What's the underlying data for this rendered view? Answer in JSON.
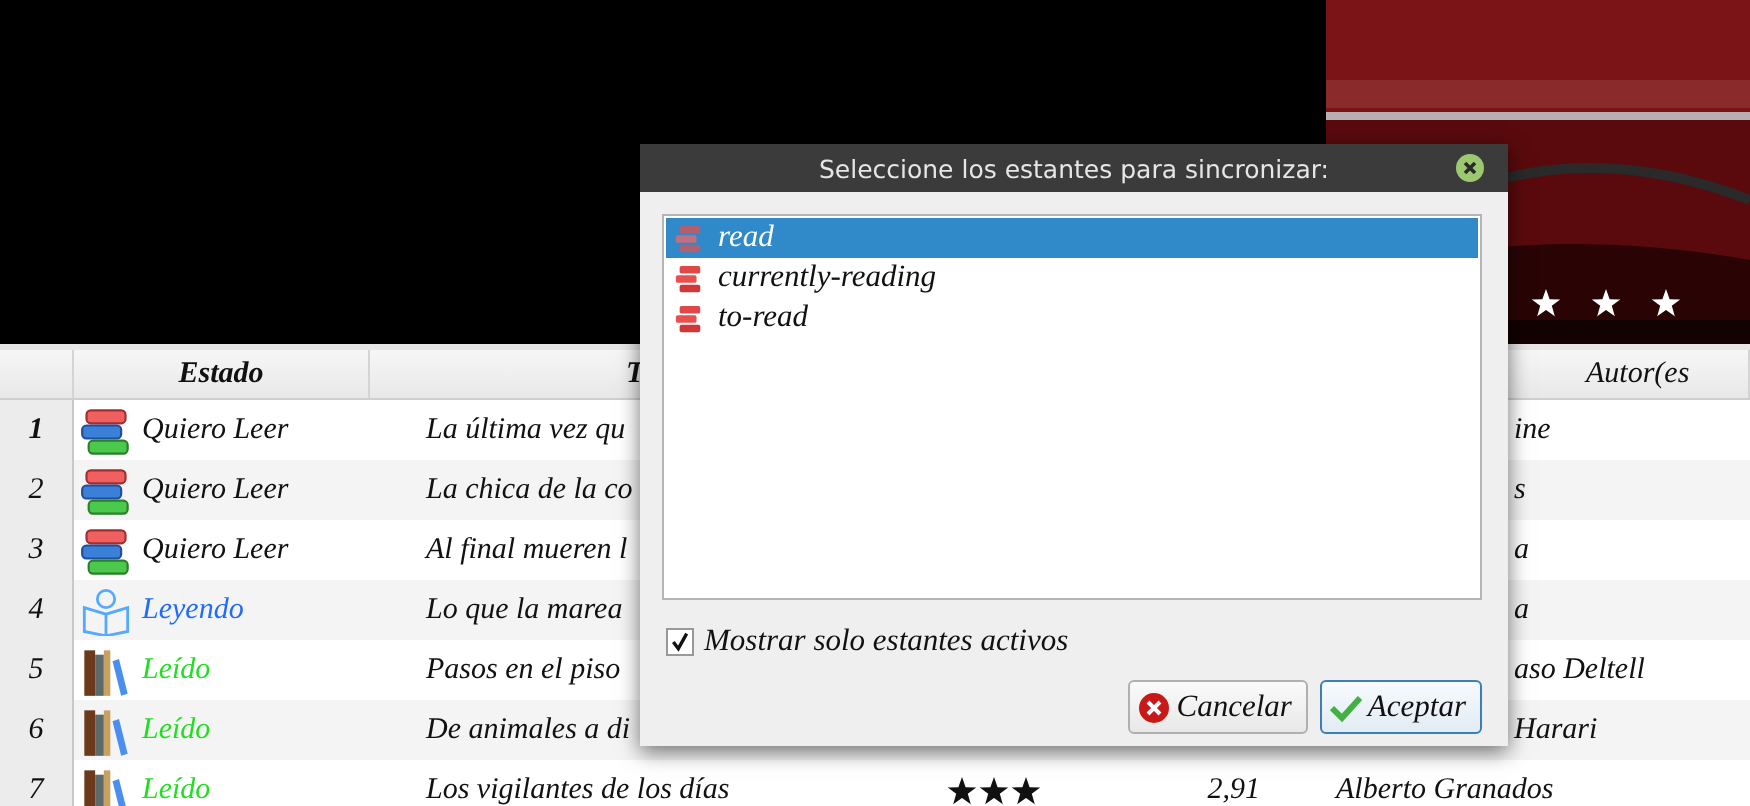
{
  "table": {
    "columns": [
      "",
      "Estado",
      "T",
      "",
      "",
      "Autor(es"
    ],
    "rows": [
      {
        "number": "1",
        "current": true,
        "status": "Quiero Leer",
        "kind": "want",
        "title": "La última vez qu",
        "author": "ine"
      },
      {
        "number": "2",
        "current": false,
        "status": "Quiero Leer",
        "kind": "want",
        "title": "La chica de la co",
        "author": "s"
      },
      {
        "number": "3",
        "current": false,
        "status": "Quiero Leer",
        "kind": "want",
        "title": "Al final mueren l",
        "author": "a"
      },
      {
        "number": "4",
        "current": false,
        "status": "Leyendo",
        "kind": "reading",
        "title": "Lo que la marea",
        "author": "a"
      },
      {
        "number": "5",
        "current": false,
        "status": "Leído",
        "kind": "read",
        "title": "Pasos en el piso",
        "author": "aso Deltell"
      },
      {
        "number": "6",
        "current": false,
        "status": "Leído",
        "kind": "read",
        "title": "De animales a di",
        "author": "Harari"
      },
      {
        "number": "7",
        "current": false,
        "status": "Leído",
        "kind": "read",
        "title": "Los vigilantes de los días",
        "stars": 3,
        "score": "2,91",
        "author": "Alberto Granados"
      }
    ]
  },
  "dialog": {
    "title": "Seleccione los estantes para sincronizar:",
    "shelves": [
      {
        "label": "read",
        "selected": true
      },
      {
        "label": "currently-reading",
        "selected": false
      },
      {
        "label": "to-read",
        "selected": false
      }
    ],
    "checkbox": {
      "label": "Mostrar solo estantes activos",
      "checked": true
    },
    "buttons": [
      {
        "label": "Cancelar",
        "kind": "cancel",
        "focused": false
      },
      {
        "label": "Aceptar",
        "kind": "accept",
        "focused": true
      }
    ]
  }
}
